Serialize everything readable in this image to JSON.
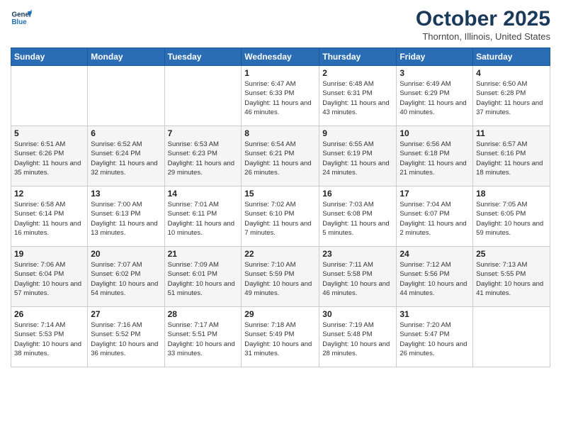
{
  "logo": {
    "line1": "General",
    "line2": "Blue"
  },
  "title": "October 2025",
  "location": "Thornton, Illinois, United States",
  "days_header": [
    "Sunday",
    "Monday",
    "Tuesday",
    "Wednesday",
    "Thursday",
    "Friday",
    "Saturday"
  ],
  "weeks": [
    [
      {
        "day": "",
        "info": ""
      },
      {
        "day": "",
        "info": ""
      },
      {
        "day": "",
        "info": ""
      },
      {
        "day": "1",
        "info": "Sunrise: 6:47 AM\nSunset: 6:33 PM\nDaylight: 11 hours\nand 46 minutes."
      },
      {
        "day": "2",
        "info": "Sunrise: 6:48 AM\nSunset: 6:31 PM\nDaylight: 11 hours\nand 43 minutes."
      },
      {
        "day": "3",
        "info": "Sunrise: 6:49 AM\nSunset: 6:29 PM\nDaylight: 11 hours\nand 40 minutes."
      },
      {
        "day": "4",
        "info": "Sunrise: 6:50 AM\nSunset: 6:28 PM\nDaylight: 11 hours\nand 37 minutes."
      }
    ],
    [
      {
        "day": "5",
        "info": "Sunrise: 6:51 AM\nSunset: 6:26 PM\nDaylight: 11 hours\nand 35 minutes."
      },
      {
        "day": "6",
        "info": "Sunrise: 6:52 AM\nSunset: 6:24 PM\nDaylight: 11 hours\nand 32 minutes."
      },
      {
        "day": "7",
        "info": "Sunrise: 6:53 AM\nSunset: 6:23 PM\nDaylight: 11 hours\nand 29 minutes."
      },
      {
        "day": "8",
        "info": "Sunrise: 6:54 AM\nSunset: 6:21 PM\nDaylight: 11 hours\nand 26 minutes."
      },
      {
        "day": "9",
        "info": "Sunrise: 6:55 AM\nSunset: 6:19 PM\nDaylight: 11 hours\nand 24 minutes."
      },
      {
        "day": "10",
        "info": "Sunrise: 6:56 AM\nSunset: 6:18 PM\nDaylight: 11 hours\nand 21 minutes."
      },
      {
        "day": "11",
        "info": "Sunrise: 6:57 AM\nSunset: 6:16 PM\nDaylight: 11 hours\nand 18 minutes."
      }
    ],
    [
      {
        "day": "12",
        "info": "Sunrise: 6:58 AM\nSunset: 6:14 PM\nDaylight: 11 hours\nand 16 minutes."
      },
      {
        "day": "13",
        "info": "Sunrise: 7:00 AM\nSunset: 6:13 PM\nDaylight: 11 hours\nand 13 minutes."
      },
      {
        "day": "14",
        "info": "Sunrise: 7:01 AM\nSunset: 6:11 PM\nDaylight: 11 hours\nand 10 minutes."
      },
      {
        "day": "15",
        "info": "Sunrise: 7:02 AM\nSunset: 6:10 PM\nDaylight: 11 hours\nand 7 minutes."
      },
      {
        "day": "16",
        "info": "Sunrise: 7:03 AM\nSunset: 6:08 PM\nDaylight: 11 hours\nand 5 minutes."
      },
      {
        "day": "17",
        "info": "Sunrise: 7:04 AM\nSunset: 6:07 PM\nDaylight: 11 hours\nand 2 minutes."
      },
      {
        "day": "18",
        "info": "Sunrise: 7:05 AM\nSunset: 6:05 PM\nDaylight: 10 hours\nand 59 minutes."
      }
    ],
    [
      {
        "day": "19",
        "info": "Sunrise: 7:06 AM\nSunset: 6:04 PM\nDaylight: 10 hours\nand 57 minutes."
      },
      {
        "day": "20",
        "info": "Sunrise: 7:07 AM\nSunset: 6:02 PM\nDaylight: 10 hours\nand 54 minutes."
      },
      {
        "day": "21",
        "info": "Sunrise: 7:09 AM\nSunset: 6:01 PM\nDaylight: 10 hours\nand 51 minutes."
      },
      {
        "day": "22",
        "info": "Sunrise: 7:10 AM\nSunset: 5:59 PM\nDaylight: 10 hours\nand 49 minutes."
      },
      {
        "day": "23",
        "info": "Sunrise: 7:11 AM\nSunset: 5:58 PM\nDaylight: 10 hours\nand 46 minutes."
      },
      {
        "day": "24",
        "info": "Sunrise: 7:12 AM\nSunset: 5:56 PM\nDaylight: 10 hours\nand 44 minutes."
      },
      {
        "day": "25",
        "info": "Sunrise: 7:13 AM\nSunset: 5:55 PM\nDaylight: 10 hours\nand 41 minutes."
      }
    ],
    [
      {
        "day": "26",
        "info": "Sunrise: 7:14 AM\nSunset: 5:53 PM\nDaylight: 10 hours\nand 38 minutes."
      },
      {
        "day": "27",
        "info": "Sunrise: 7:16 AM\nSunset: 5:52 PM\nDaylight: 10 hours\nand 36 minutes."
      },
      {
        "day": "28",
        "info": "Sunrise: 7:17 AM\nSunset: 5:51 PM\nDaylight: 10 hours\nand 33 minutes."
      },
      {
        "day": "29",
        "info": "Sunrise: 7:18 AM\nSunset: 5:49 PM\nDaylight: 10 hours\nand 31 minutes."
      },
      {
        "day": "30",
        "info": "Sunrise: 7:19 AM\nSunset: 5:48 PM\nDaylight: 10 hours\nand 28 minutes."
      },
      {
        "day": "31",
        "info": "Sunrise: 7:20 AM\nSunset: 5:47 PM\nDaylight: 10 hours\nand 26 minutes."
      },
      {
        "day": "",
        "info": ""
      }
    ]
  ]
}
